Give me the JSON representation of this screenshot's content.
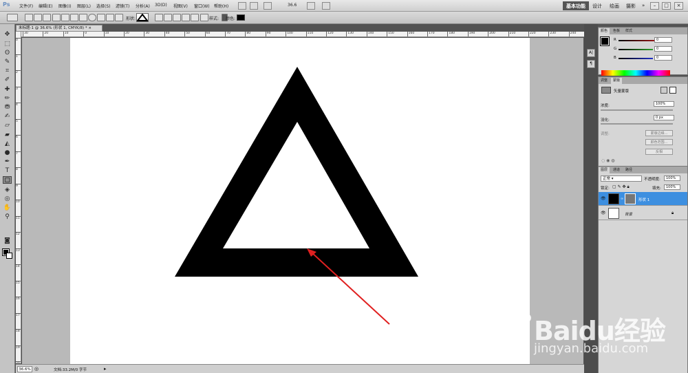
{
  "app": {
    "logo": "Ps"
  },
  "menu": [
    "文件(F)",
    "编辑(E)",
    "图像(I)",
    "图层(L)",
    "选择(S)",
    "滤镜(T)",
    "分析(A)",
    "3D(D)",
    "视图(V)",
    "窗口(W)",
    "帮助(H)"
  ],
  "menubar": {
    "zoom": "36.6",
    "workspaces": [
      "基本功能",
      "设计",
      "绘画",
      "摄影"
    ],
    "more": "»"
  },
  "options": {
    "shape_label": "形状:",
    "style_label": "样式:",
    "color_label": "颜色:",
    "shape_color": "#000000"
  },
  "document": {
    "tab_title": "未标题-1 @ 36.6% (形状 1, CMYK/8) *"
  },
  "rulers": {
    "top": [
      "30",
      "20",
      "10",
      "0",
      "10",
      "20",
      "30",
      "40",
      "50",
      "60",
      "70",
      "80",
      "90",
      "100",
      "110",
      "120",
      "130",
      "140",
      "150",
      "160",
      "170",
      "180",
      "190",
      "200",
      "210",
      "220",
      "230",
      "240"
    ],
    "left": [
      "0",
      "1",
      "2",
      "3",
      "4",
      "5",
      "6",
      "7",
      "8",
      "9",
      "10",
      "11",
      "12",
      "13",
      "14",
      "15",
      "16",
      "17",
      "18",
      "19",
      "20"
    ]
  },
  "status": {
    "zoom": "36.6%",
    "doc_info": "文档:33.2M/0 字节"
  },
  "color_panel": {
    "tabs": [
      "颜色",
      "色板",
      "样式"
    ],
    "channels": [
      {
        "label": "R",
        "value": "0",
        "color": "#d42020"
      },
      {
        "label": "G",
        "value": "0",
        "color": "#2aa02a"
      },
      {
        "label": "B",
        "value": "0",
        "color": "#2030c8"
      }
    ]
  },
  "masks_panel": {
    "tabs": [
      "调整",
      "蒙版"
    ],
    "title": "矢量蒙版",
    "density_label": "浓度:",
    "density_value": "100%",
    "feather_label": "羽化:",
    "feather_value": "0 px",
    "refine_label": "调整:",
    "buttons": [
      "蒙版边缘...",
      "颜色范围...",
      "反相"
    ]
  },
  "layers_panel": {
    "tabs": [
      "图层",
      "通道",
      "路径"
    ],
    "blend_mode": "正常",
    "opacity_label": "不透明度:",
    "opacity_value": "100%",
    "lock_label": "锁定:",
    "fill_label": "填充:",
    "fill_value": "100%",
    "layers": [
      {
        "name": "形状 1",
        "selected": true
      },
      {
        "name": "背景",
        "selected": false
      }
    ]
  },
  "watermark": {
    "brand": "Baidu经验",
    "url": "jingyan.baidu.com"
  },
  "colors": {
    "ui_gray": "#535353",
    "selection": "#3d8fe0",
    "arrow": "#e02020",
    "shape": "#000000"
  }
}
